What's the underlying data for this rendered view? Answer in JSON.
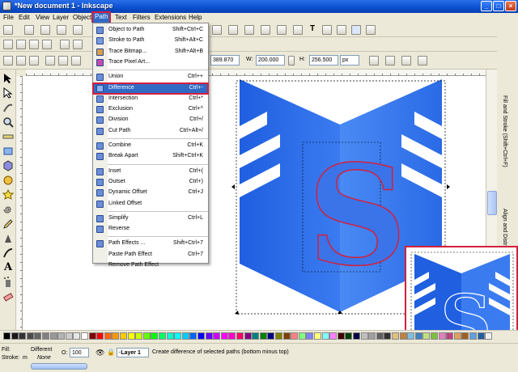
{
  "window": {
    "title": "*New document 1 - Inkscape"
  },
  "menubar": {
    "items": [
      "File",
      "Edit",
      "View",
      "Layer",
      "Object",
      "Path",
      "Text",
      "Filters",
      "Extensions",
      "Help"
    ],
    "active": "Path"
  },
  "path_menu": {
    "groups": [
      [
        {
          "label": "Object to Path",
          "shortcut": "Shift+Ctrl+C",
          "icon": "object-to-path-icon",
          "color": "#6a8fd8"
        },
        {
          "label": "Stroke to Path",
          "shortcut": "Shift+Alt+C",
          "icon": "stroke-to-path-icon",
          "color": "#7a9adf"
        },
        {
          "label": "Trace Bitmap...",
          "shortcut": "Shift+Alt+B",
          "icon": "trace-bitmap-icon",
          "color": "#d9a14a"
        },
        {
          "label": "Trace Pixel Art...",
          "shortcut": "",
          "icon": "trace-pixel-art-icon",
          "color": "#c24ab0"
        }
      ],
      [
        {
          "label": "Union",
          "shortcut": "Ctrl++",
          "icon": "union-icon",
          "color": "#6a8fd8"
        },
        {
          "label": "Difference",
          "shortcut": "Ctrl+-",
          "icon": "difference-icon",
          "color": "#8fb3f0",
          "highlighted": true
        },
        {
          "label": "Intersection",
          "shortcut": "Ctrl+*",
          "icon": "intersection-icon",
          "color": "#6a8fd8"
        },
        {
          "label": "Exclusion",
          "shortcut": "Ctrl+^",
          "icon": "exclusion-icon",
          "color": "#6a8fd8"
        },
        {
          "label": "Division",
          "shortcut": "Ctrl+/",
          "icon": "division-icon",
          "color": "#6a8fd8"
        },
        {
          "label": "Cut Path",
          "shortcut": "Ctrl+Alt+/",
          "icon": "cut-path-icon",
          "color": "#6a8fd8"
        }
      ],
      [
        {
          "label": "Combine",
          "shortcut": "Ctrl+K",
          "icon": "combine-icon",
          "color": "#6a8fd8"
        },
        {
          "label": "Break Apart",
          "shortcut": "Shift+Ctrl+K",
          "icon": "break-apart-icon",
          "color": "#6a8fd8"
        }
      ],
      [
        {
          "label": "Inset",
          "shortcut": "Ctrl+(",
          "icon": "inset-icon",
          "color": "#6a8fd8"
        },
        {
          "label": "Outset",
          "shortcut": "Ctrl+)",
          "icon": "outset-icon",
          "color": "#6a8fd8"
        },
        {
          "label": "Dynamic Offset",
          "shortcut": "Ctrl+J",
          "icon": "dynamic-offset-icon",
          "color": "#6a8fd8"
        },
        {
          "label": "Linked Offset",
          "shortcut": "",
          "icon": "linked-offset-icon",
          "color": "#6a8fd8"
        }
      ],
      [
        {
          "label": "Simplify",
          "shortcut": "Ctrl+L",
          "icon": "simplify-icon",
          "color": "#6a8fd8"
        },
        {
          "label": "Reverse",
          "shortcut": "",
          "icon": "reverse-icon",
          "color": "#6a8fd8"
        }
      ],
      [
        {
          "label": "Path Effects ...",
          "shortcut": "Shift+Ctrl+7",
          "icon": "path-effects-icon",
          "color": "#6a8fd8"
        },
        {
          "label": "Paste Path Effect",
          "shortcut": "Ctrl+7",
          "icon": "",
          "color": ""
        },
        {
          "label": "Remove Path Effect",
          "shortcut": "",
          "icon": "",
          "color": ""
        }
      ]
    ]
  },
  "select_toolbar": {
    "y_value": "389.870",
    "w_label": "W:",
    "w_value": "200.000",
    "h_label": "H:",
    "h_value": "256.500",
    "unit": "px"
  },
  "dock_tabs": [
    "Fill and Stroke (Shift+Ctrl+F)",
    "Align and Distribute (Shift+Ctrl+A)"
  ],
  "status": {
    "fill_label": "Fill:",
    "fill_value": "Different",
    "stroke_label": "Stroke:",
    "stroke_unit": "m",
    "stroke_value": "None",
    "opacity_label": "O:",
    "opacity_value": "100",
    "layer": "·Layer 1",
    "message": "Create difference of selected paths (bottom minus top)"
  },
  "colors": {
    "accent_highlight": "#d4203c",
    "menu_selection": "#316ac5",
    "shape_blue": "#1f5fe0",
    "shape_blue_light": "#3b7bf0"
  },
  "palette": [
    "#000000",
    "#1a1a1a",
    "#333333",
    "#4d4d4d",
    "#666666",
    "#808080",
    "#999999",
    "#b3b3b3",
    "#cccccc",
    "#e6e6e6",
    "#ffffff",
    "#800000",
    "#ff0000",
    "#ff6600",
    "#ff9900",
    "#ffcc00",
    "#ffff00",
    "#ccff00",
    "#66ff00",
    "#00ff00",
    "#00ff66",
    "#00ffcc",
    "#00ffff",
    "#00ccff",
    "#0066ff",
    "#0000ff",
    "#6600ff",
    "#cc00ff",
    "#ff00ff",
    "#ff00cc",
    "#ff0066",
    "#800080",
    "#008080",
    "#008000",
    "#000080",
    "#808000",
    "#804000",
    "#ff8080",
    "#80ff80",
    "#8080ff",
    "#ffff80",
    "#80ffff",
    "#ff80ff",
    "#400000",
    "#004000",
    "#000040",
    "#c0c0c0",
    "#a0a0a0",
    "#606060",
    "#303030",
    "#e0c080",
    "#c08040",
    "#80c0e0",
    "#4080c0",
    "#c0e080",
    "#80c040",
    "#e080c0",
    "#c04080",
    "#e0a060",
    "#a06020",
    "#60a0e0",
    "#2060a0",
    "#f0f0f0"
  ]
}
